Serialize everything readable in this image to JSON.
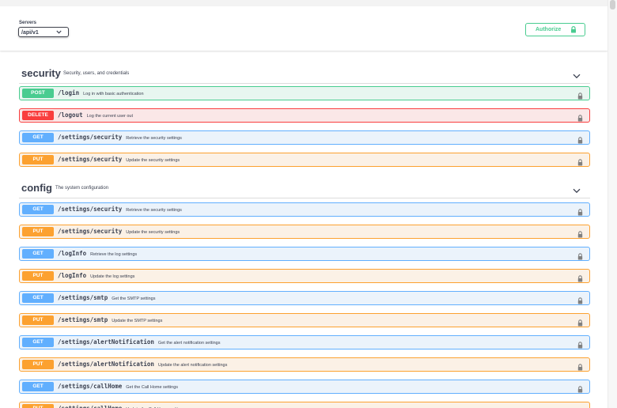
{
  "servers": {
    "label": "Servers",
    "selected": "/api/v1"
  },
  "authorize": {
    "label": "Authorize",
    "icon": "lock-icon"
  },
  "colors": {
    "get": "#61affe",
    "post": "#49cc90",
    "put": "#fca130",
    "delete": "#f93e3e"
  },
  "tags": [
    {
      "name": "security",
      "description": "Security, users, and credentials",
      "operations": [
        {
          "method": "POST",
          "path": "/login",
          "summary": "Log in with basic authentication"
        },
        {
          "method": "DELETE",
          "path": "/logout",
          "summary": "Log the current user out"
        },
        {
          "method": "GET",
          "path": "/settings/security",
          "summary": "Retrieve the security settings"
        },
        {
          "method": "PUT",
          "path": "/settings/security",
          "summary": "Update the security settings"
        }
      ]
    },
    {
      "name": "config",
      "description": "The system configuration",
      "operations": [
        {
          "method": "GET",
          "path": "/settings/security",
          "summary": "Retrieve the security settings"
        },
        {
          "method": "PUT",
          "path": "/settings/security",
          "summary": "Update the security settings"
        },
        {
          "method": "GET",
          "path": "/logInfo",
          "summary": "Retrieve the log settings"
        },
        {
          "method": "PUT",
          "path": "/logInfo",
          "summary": "Update the log settings"
        },
        {
          "method": "GET",
          "path": "/settings/smtp",
          "summary": "Get the SMTP settings"
        },
        {
          "method": "PUT",
          "path": "/settings/smtp",
          "summary": "Update the SMTP settings"
        },
        {
          "method": "GET",
          "path": "/settings/alertNotification",
          "summary": "Get the alert notification settings"
        },
        {
          "method": "PUT",
          "path": "/settings/alertNotification",
          "summary": "Update the alert notification settings"
        },
        {
          "method": "GET",
          "path": "/settings/callHome",
          "summary": "Get the Call Home settings"
        },
        {
          "method": "PUT",
          "path": "/settings/callHome",
          "summary": "Update the Call Home settings"
        }
      ]
    }
  ]
}
